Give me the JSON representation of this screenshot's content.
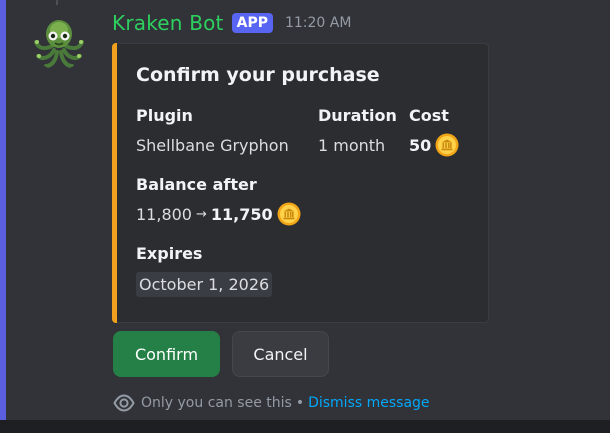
{
  "message": {
    "author": "Kraken Bot",
    "badge": "APP",
    "timestamp": "11:20 AM"
  },
  "embed": {
    "title": "Confirm your purchase",
    "accent_color": "#f0a01e",
    "fields": {
      "plugin": {
        "name": "Plugin",
        "value": "Shellbane Gryphon"
      },
      "duration": {
        "name": "Duration",
        "value": "1 month"
      },
      "cost": {
        "name": "Cost",
        "value": "50",
        "icon": "coin-icon"
      },
      "balance": {
        "name": "Balance after",
        "from": "11,800",
        "arrow": "→",
        "to": "11,750",
        "icon": "coin-icon"
      },
      "expires": {
        "name": "Expires",
        "value": "October 1, 2026"
      }
    }
  },
  "buttons": {
    "confirm": "Confirm",
    "cancel": "Cancel"
  },
  "ephemeral": {
    "text": "Only you can see this",
    "separator": "•",
    "dismiss": "Dismiss message"
  },
  "colors": {
    "username": "#2dd05f",
    "badge": "#5865f2",
    "confirm_button": "#248046",
    "link": "#00a8fc",
    "highlight_bar": "#5a5fe0"
  }
}
